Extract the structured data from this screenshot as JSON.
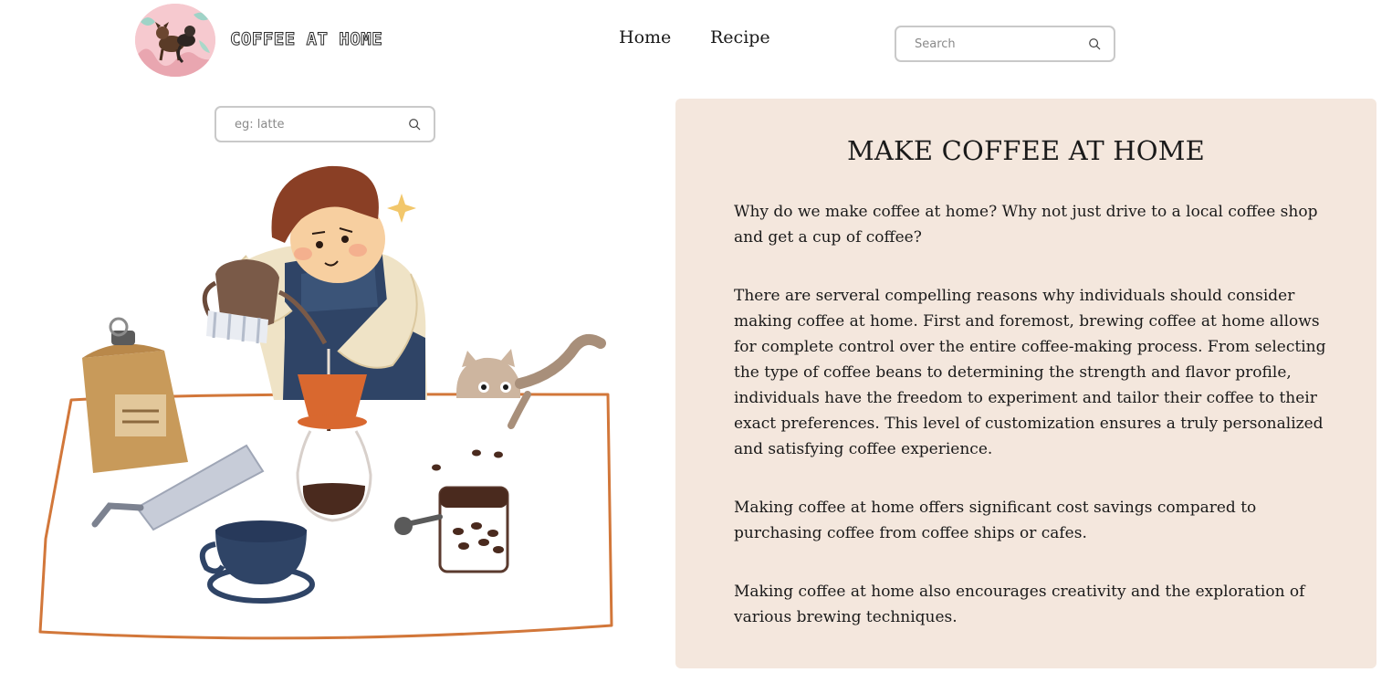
{
  "header": {
    "brand": "COFFEE AT HOME",
    "logo_icon": "dog-and-cat-avatar-icon",
    "nav": [
      {
        "label": "Home"
      },
      {
        "label": "Recipe"
      }
    ],
    "search": {
      "placeholder": "Search",
      "icon": "search-icon"
    }
  },
  "sidebar": {
    "search": {
      "placeholder": "eg: latte",
      "icon": "search-icon"
    },
    "illustration": "barista-pour-over-coffee-illustration"
  },
  "article": {
    "title": "MAKE COFFEE AT HOME",
    "paragraphs": [
      "Why do we make coffee at home? Why not just drive to a local coffee shop and get a cup of coffee?",
      "There are serveral compelling reasons why individuals should consider making coffee at home. First and foremost, brewing coffee at home allows for complete control over the entire coffee-making process. From selecting the type of coffee beans to determining the strength and flavor profile, individuals have the freedom to experiment and tailor their coffee to their exact preferences. This level of customization ensures a truly personalized and satisfying coffee experience.",
      "Making coffee at home offers significant cost savings compared to purchasing coffee from coffee ships or cafes.",
      "Making coffee at home also encourages creativity and the exploration of various brewing techniques."
    ]
  },
  "colors": {
    "panel_background": "#f4e7dd",
    "table_outline": "#d2773a",
    "apron_blue": "#2f4466",
    "hair_brown": "#8a3f25",
    "dripper_orange": "#d9682f"
  }
}
